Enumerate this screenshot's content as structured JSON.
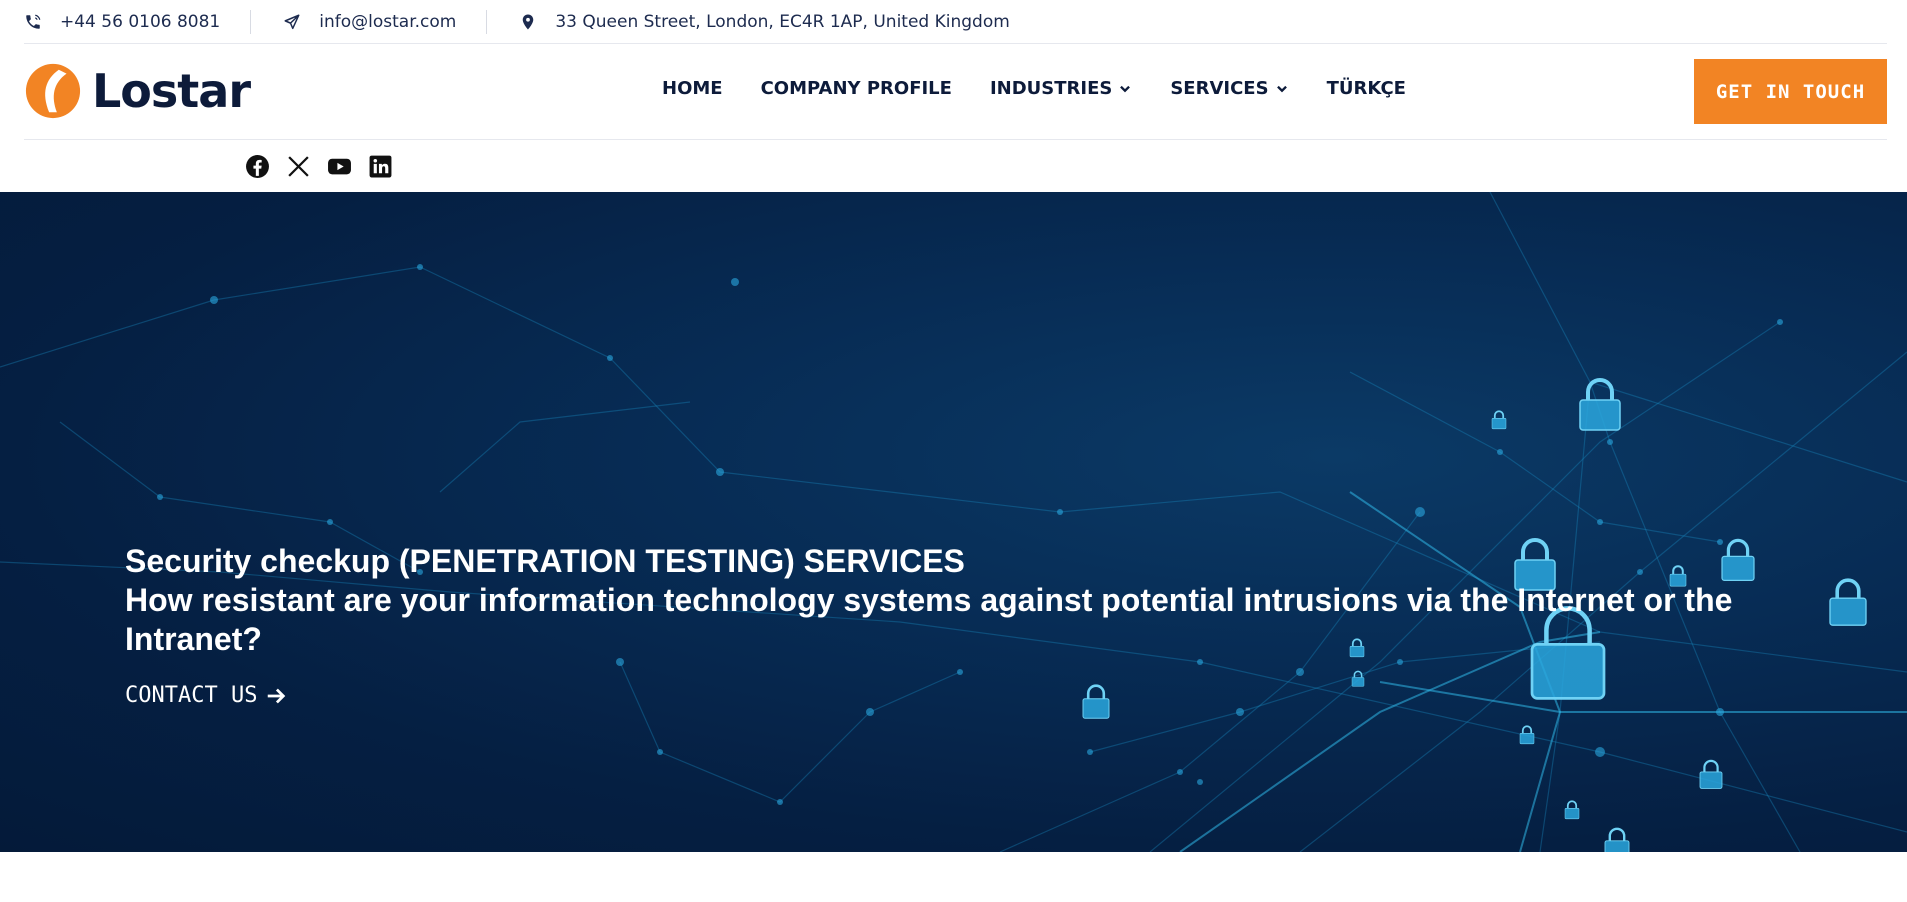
{
  "topbar": {
    "phone": "+44 56 0106 8081",
    "email": "info@lostar.com",
    "address": "33 Queen Street, London, EC4R 1AP, United Kingdom"
  },
  "header": {
    "logo_text": "Lostar",
    "nav": [
      {
        "label": "HOME",
        "dropdown": false
      },
      {
        "label": "COMPANY PROFILE",
        "dropdown": false
      },
      {
        "label": "INDUSTRIES",
        "dropdown": true
      },
      {
        "label": "SERVICES",
        "dropdown": true
      },
      {
        "label": "TÜRKÇE",
        "dropdown": false
      }
    ],
    "cta_label": "GET IN TOUCH"
  },
  "social": [
    "facebook-icon",
    "x-icon",
    "youtube-icon",
    "linkedin-icon"
  ],
  "hero": {
    "title_line1": "Security checkup (PENETRATION TESTING) SERVICES",
    "title_line2": "How resistant are your information technology systems against potential intrusions via the Internet or the Intranet?",
    "link_label": "CONTACT US"
  },
  "colors": {
    "accent": "#f28424",
    "navy": "#0d1b3a",
    "hero_bg": "#072c55"
  }
}
